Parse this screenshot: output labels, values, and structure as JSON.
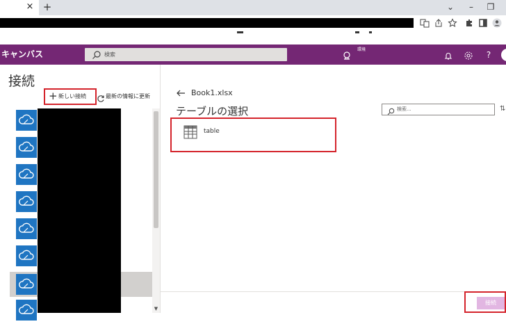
{
  "browser": {
    "tab_close": "×",
    "new_tab": "+",
    "window_controls": [
      "⌄",
      "–",
      "❐"
    ]
  },
  "app": {
    "title": "キャンバス",
    "search_placeholder": "検索",
    "environment_label": "環境",
    "help_label": "?"
  },
  "left_panel": {
    "title": "接続",
    "new_connection_label": "新しい接続",
    "refresh_label": "最新の情報に更新",
    "connections_count_visible": 8,
    "selected_index": 6
  },
  "main": {
    "file_name": "Book1.xlsx",
    "section_title": "テーブルの選択",
    "search_placeholder": "検索...",
    "tables": [
      {
        "label": "table"
      }
    ]
  },
  "footer": {
    "connect_label": "接続"
  },
  "colors": {
    "header_bg": "#742774",
    "connector_tile": "#1f75c2",
    "connect_button": "#e2b6e2",
    "highlight": "#d4232b"
  }
}
